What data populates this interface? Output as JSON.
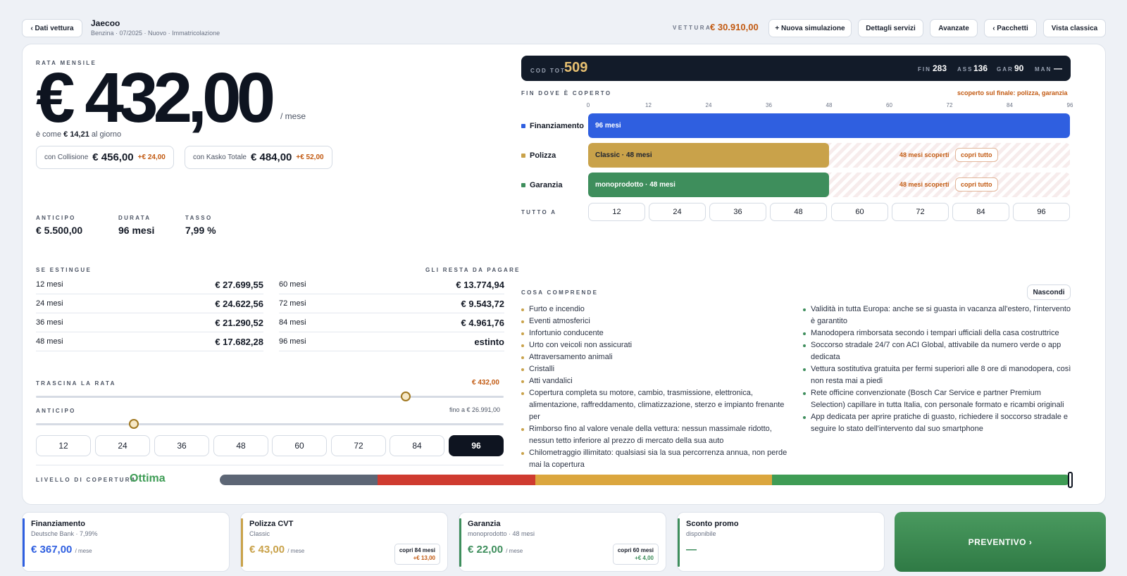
{
  "header": {
    "back_label": "‹ Dati vettura",
    "car_name": "Jaecoo",
    "car_details": "Benzina · 07/2025 · Nuovo · Immatricolazione",
    "vehicle_label": "VETTURA",
    "vehicle_price": "€ 30.910,00",
    "buttons": [
      "+ Nuova simulazione",
      "Dettagli servizi",
      "Avanzate",
      "‹ Pacchetti",
      "Vista classica"
    ]
  },
  "rate": {
    "label": "RATA MENSILE",
    "amount": "€ 432,00",
    "per_month": "/ mese",
    "daily_prefix": "è come",
    "daily_value": "€ 14,21",
    "daily_suffix": "al giorno",
    "options": [
      {
        "label": "con Collisione",
        "value": "€ 456,00",
        "delta": "+€ 24,00"
      },
      {
        "label": "con Kasko Totale",
        "value": "€ 484,00",
        "delta": "+€ 52,00"
      }
    ]
  },
  "terms": {
    "anticipo_label": "ANTICIPO",
    "anticipo_value": "€ 5.500,00",
    "durata_label": "DURATA",
    "durata_value": "96 mesi",
    "tasso_label": "TASSO",
    "tasso_value": "7,99 %"
  },
  "payoff": {
    "left_label": "SE ESTINGUE",
    "right_label": "GLI RESTA DA PAGARE",
    "left_rows": [
      {
        "months": "12 mesi",
        "value": "€ 27.699,55"
      },
      {
        "months": "24 mesi",
        "value": "€ 24.622,56"
      },
      {
        "months": "36 mesi",
        "value": "€ 21.290,52"
      },
      {
        "months": "48 mesi",
        "value": "€ 17.682,28"
      }
    ],
    "right_rows": [
      {
        "months": "60 mesi",
        "value": "€ 13.774,94"
      },
      {
        "months": "72 mesi",
        "value": "€ 9.543,72"
      },
      {
        "months": "84 mesi",
        "value": "€ 4.961,76"
      },
      {
        "months": "96 mesi",
        "value": "estinto"
      }
    ]
  },
  "sliders": {
    "rata_label": "TRASCINA LA RATA",
    "rata_value": "€ 432,00",
    "rata_fraction": 0.79,
    "anticipo_label": "ANTICIPO",
    "anticipo_max": "fino a € 26.991,00",
    "anticipo_fraction": 0.21
  },
  "durations": [
    "12",
    "24",
    "36",
    "48",
    "60",
    "72",
    "84",
    "96"
  ],
  "selected_duration": "96",
  "coverage_level": {
    "label": "LIVELLO DI COPERTURA",
    "value": "Ottima",
    "segment_colors": [
      "#5d6675",
      "#cf3b30",
      "#dba63e",
      "#3f9c55"
    ]
  },
  "cod": {
    "label": "COD TOT",
    "value": "509",
    "items": [
      {
        "label": "FIN",
        "value": "283"
      },
      {
        "label": "ASS",
        "value": "136"
      },
      {
        "label": "GAR",
        "value": "90"
      },
      {
        "label": "MAN",
        "value": "—"
      }
    ]
  },
  "timeline": {
    "label": "FIN DOVE È COPERTO",
    "warning": "scoperto sul finale: polizza, garanzia",
    "ticks": [
      "0",
      "12",
      "24",
      "36",
      "48",
      "60",
      "72",
      "84",
      "96"
    ],
    "max_months": 96,
    "lanes": [
      {
        "name": "Finanziamento",
        "bar_label": "96 mesi",
        "covered_months": 96,
        "color": "#2f5fe0",
        "uncovered": "",
        "cta": ""
      },
      {
        "name": "Polizza",
        "bar_label": "Classic · 48 mesi",
        "covered_months": 48,
        "color": "#c9a24a",
        "uncovered": "48 mesi scoperti",
        "cta": "copri tutto"
      },
      {
        "name": "Garanzia",
        "bar_label": "monoprodotto · 48 mesi",
        "covered_months": 48,
        "color": "#3e8e5c",
        "uncovered": "48 mesi scoperti",
        "cta": "copri tutto"
      }
    ],
    "all_label": "TUTTO A",
    "all_options": [
      "12",
      "24",
      "36",
      "48",
      "60",
      "72",
      "84",
      "96"
    ]
  },
  "includes": {
    "label": "COSA COMPRENDE",
    "hide_label": "Nascondi",
    "left": [
      "Furto e incendio",
      "Eventi atmosferici",
      "Infortunio conducente",
      "Urto con veicoli non assicurati",
      "Attraversamento animali",
      "Cristalli",
      "Atti vandalici",
      "Copertura completa su motore, cambio, trasmissione, elettronica, alimentazione, raffreddamento, climatizzazione, sterzo e impianto frenante per",
      "Rimborso fino al valore venale della vettura: nessun massimale ridotto, nessun tetto inferiore al prezzo di mercato della sua auto",
      "Chilometraggio illimitato: qualsiasi sia la sua percorrenza annua, non perde mai la copertura"
    ],
    "right": [
      "Validità in tutta Europa: anche se si guasta in vacanza all'estero, l'intervento è garantito",
      "Manodopera rimborsata secondo i tempari ufficiali della casa costruttrice",
      "Soccorso stradale 24/7 con ACI Global, attivabile da numero verde o app dedicata",
      "Vettura sostitutiva gratuita per fermi superiori alle 8 ore di manodopera, così non resta mai a piedi",
      "Rete officine convenzionate (Bosch Car Service e partner Premium Selection) capillare in tutta Italia, con personale formato e ricambi originali",
      "App dedicata per aprire pratiche di guasto, richiedere il soccorso stradale e seguire lo stato dell'intervento dal suo smartphone"
    ]
  },
  "footer": {
    "cards": [
      {
        "title": "Finanziamento",
        "sub": "Deutsche Bank · 7,99%",
        "value": "€ 367,00",
        "unit": "/ mese",
        "color": "#2f5fe0",
        "badge": "",
        "badge_delta": ""
      },
      {
        "title": "Polizza CVT",
        "sub": "Classic",
        "value": "€ 43,00",
        "unit": "/ mese",
        "color": "#c9a24a",
        "badge": "copri 84 mesi",
        "badge_delta": "+€ 13,00"
      },
      {
        "title": "Garanzia",
        "sub": "monoprodotto · 48 mesi",
        "value": "€ 22,00",
        "unit": "/ mese",
        "color": "#3e8e5c",
        "badge": "copri 60 mesi",
        "badge_delta": "+€ 4,00"
      },
      {
        "title": "Sconto promo",
        "sub": "disponibile",
        "value": "—",
        "unit": "",
        "color": "#3e8e5c",
        "badge": "",
        "badge_delta": ""
      }
    ],
    "cta": "PREVENTIVO ›"
  }
}
